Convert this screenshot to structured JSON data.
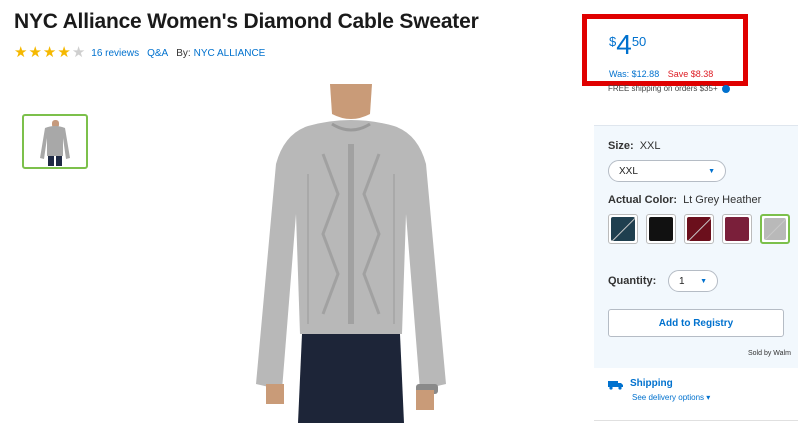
{
  "product": {
    "title": "NYC Alliance Women's Diamond Cable Sweater",
    "rating": 4,
    "rating_max": 5,
    "reviews_label": "16 reviews",
    "qa_label": "Q&A",
    "by_label": "By:",
    "brand": "NYC ALLIANCE"
  },
  "price": {
    "currency": "$",
    "dollars": "4",
    "cents": "50",
    "was": "Was: $12.88",
    "save": "Save $8.38"
  },
  "shipping_note": "FREE shipping on orders $35+",
  "options": {
    "size_label": "Size:",
    "size_value": "XXL",
    "size_selected": "XXL",
    "color_label": "Actual Color:",
    "color_value": "Lt Grey Heather",
    "swatches": [
      {
        "name": "teal-navy",
        "color": "#1f3f4f"
      },
      {
        "name": "black",
        "color": "#111111"
      },
      {
        "name": "burgundy",
        "color": "#6b0f1c"
      },
      {
        "name": "wine",
        "color": "#7a1f3a"
      },
      {
        "name": "lt-grey-heather",
        "color": "#b9b9b9",
        "selected": true
      }
    ],
    "quantity_label": "Quantity:",
    "quantity_value": "1",
    "registry_label": "Add to Registry",
    "sold_by": "Sold by Walm"
  },
  "shipping": {
    "title": "Shipping",
    "options_link": "See delivery options"
  },
  "colors": {
    "accent": "#0071ce",
    "highlight_box": "#e00000",
    "save_red": "#de1c24",
    "star": "#f5b800",
    "selected_border": "#7cc04b"
  }
}
